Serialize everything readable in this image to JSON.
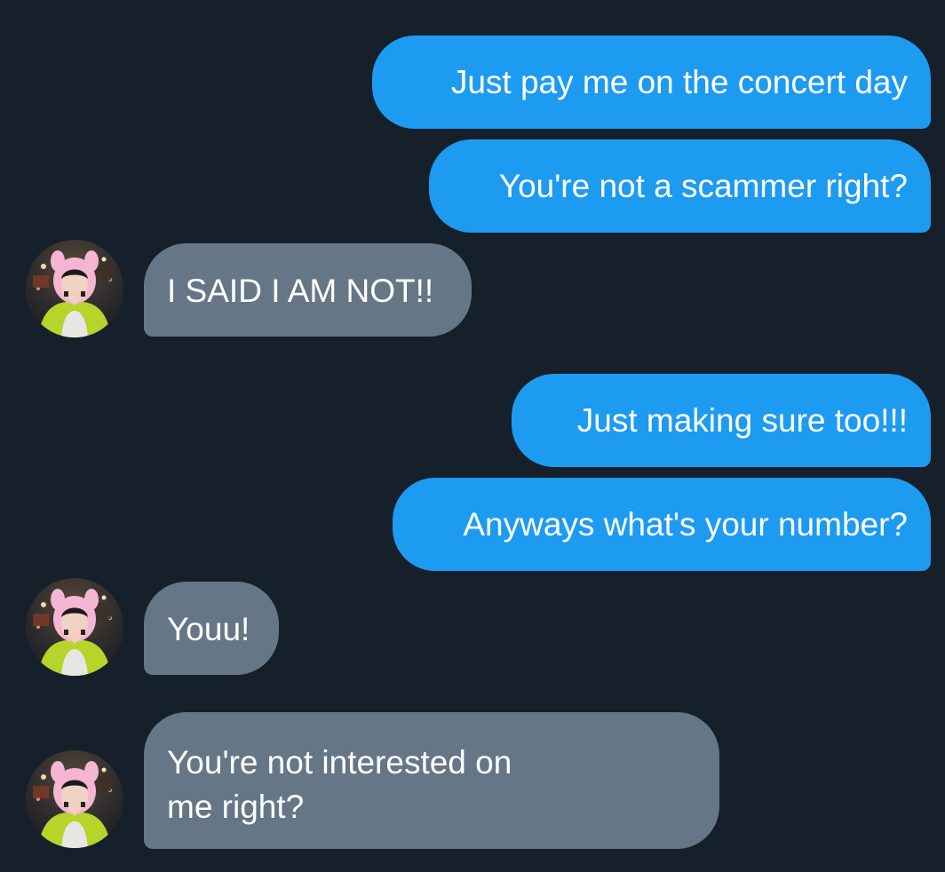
{
  "conversation": {
    "messages": [
      {
        "direction": "outgoing",
        "text": "Just pay me on the concert day"
      },
      {
        "direction": "outgoing",
        "text": "You're not a scammer right?"
      },
      {
        "direction": "incoming",
        "text": "I SAID I AM NOT!!"
      },
      {
        "direction": "outgoing",
        "text": "Just making sure too!!!"
      },
      {
        "direction": "outgoing",
        "text": "Anyways what's your number?"
      },
      {
        "direction": "incoming",
        "text": "Youu!"
      },
      {
        "direction": "incoming",
        "lines": [
          "You're not interested on",
          "me right?"
        ]
      }
    ]
  },
  "colors": {
    "background": "#15202b",
    "outgoing_bubble": "#1d9bf0",
    "incoming_bubble": "#657786",
    "text": "#ffffff"
  }
}
